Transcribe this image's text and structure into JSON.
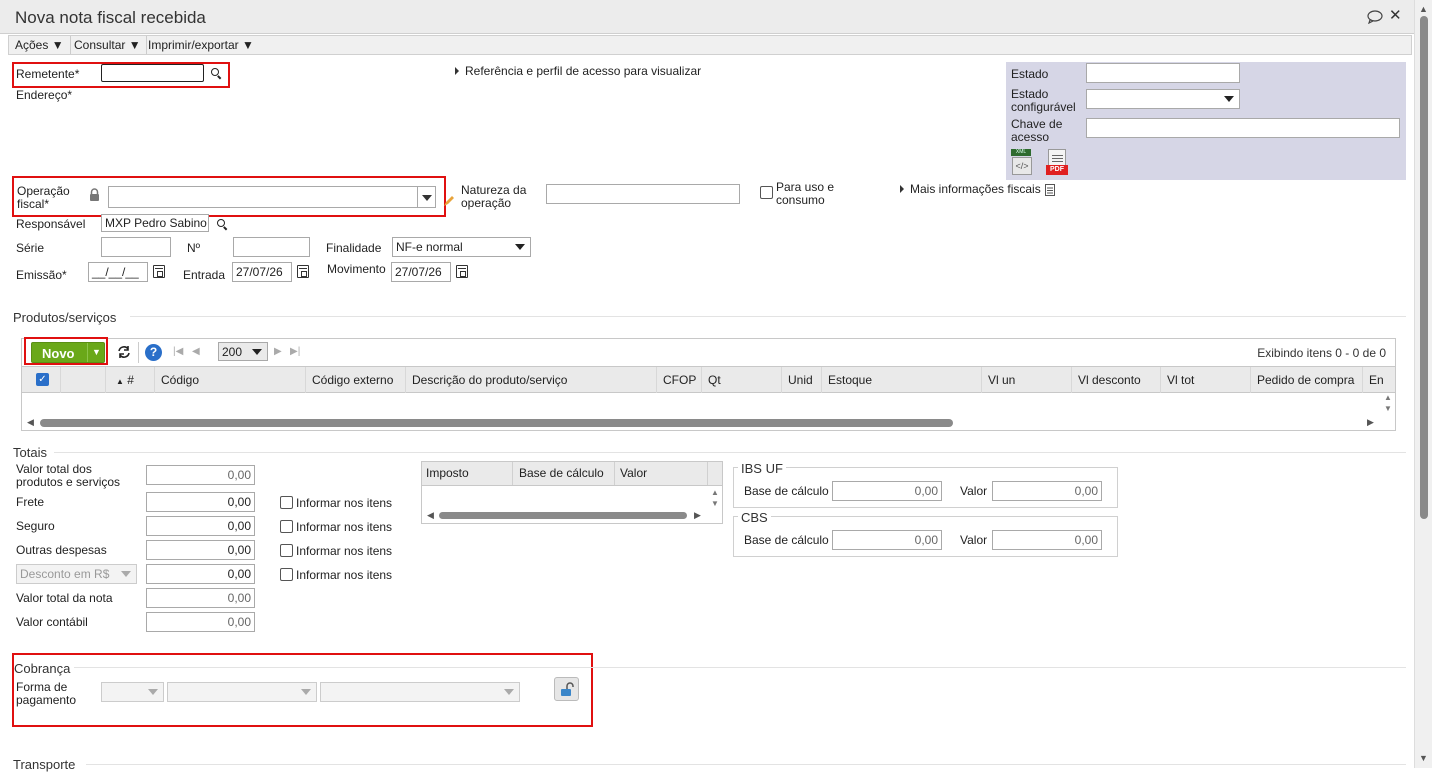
{
  "window": {
    "title": "Nova nota fiscal recebida"
  },
  "menu": {
    "acoes": "Ações",
    "consultar": "Consultar",
    "imprimir": "Imprimir/exportar"
  },
  "header": {
    "remetente_label": "Remetente*",
    "remetente_value": "",
    "endereco_label": "Endereço*",
    "referencia_link": "Referência e perfil de acesso para visualizar"
  },
  "side_panel": {
    "estado_label": "Estado",
    "estado_value": "",
    "estado_config_label_1": "Estado",
    "estado_config_label_2": "configurável",
    "estado_config_value": "",
    "chave_label_1": "Chave de",
    "chave_label_2": "acesso",
    "chave_value": "",
    "xml_badge": "XML",
    "pdf_badge": "PDF"
  },
  "operacao": {
    "label_1": "Operação",
    "label_2": "fiscal*",
    "value": "",
    "natureza_label_1": "Natureza da",
    "natureza_label_2": "operação",
    "natureza_value": "",
    "uso_consumo_1": "Para uso e",
    "uso_consumo_2": "consumo",
    "mais_info": "Mais informações fiscais"
  },
  "responsavel": {
    "label": "Responsável",
    "value": "MXP Pedro Sabino"
  },
  "serie": {
    "label": "Série",
    "value": "",
    "numero_label": "Nº",
    "numero_value": "",
    "finalidade_label": "Finalidade",
    "finalidade_value": "NF-e normal"
  },
  "datas": {
    "emissao_label": "Emissão*",
    "emissao_value": "__/__/__",
    "entrada_label": "Entrada",
    "entrada_value": "27/07/26",
    "movimento_label": "Movimento",
    "movimento_value": "27/07/26"
  },
  "produtos": {
    "section_title": "Produtos/serviços",
    "novo_button": "Novo",
    "page_size": "200",
    "exibindo": "Exibindo itens 0 - 0 de 0",
    "columns": [
      "#",
      "Código",
      "Código externo",
      "Descrição do produto/serviço",
      "CFOP",
      "Qt",
      "Unid",
      "Estoque",
      "Vl un",
      "Vl desconto",
      "Vl tot",
      "Pedido de compra",
      "En"
    ]
  },
  "totais": {
    "section_title": "Totais",
    "valor_total_1": "Valor total dos",
    "valor_total_2": "produtos e serviços",
    "valor_total_value": "0,00",
    "frete_label": "Frete",
    "frete_value": "0,00",
    "seguro_label": "Seguro",
    "seguro_value": "0,00",
    "outras_label": "Outras despesas",
    "outras_value": "0,00",
    "desconto_select": "Desconto em R$",
    "desconto_value": "0,00",
    "valor_nota_label": "Valor total da nota",
    "valor_nota_value": "0,00",
    "valor_contabil_label": "Valor contábil",
    "valor_contabil_value": "0,00",
    "informar_itens": "Informar nos itens"
  },
  "impostos": {
    "columns": [
      "Imposto",
      "Base de cálculo",
      "Valor"
    ]
  },
  "ibs_uf": {
    "title": "IBS UF",
    "base_label": "Base de cálculo",
    "base_value": "0,00",
    "valor_label": "Valor",
    "valor_value": "0,00"
  },
  "cbs": {
    "title": "CBS",
    "base_label": "Base de cálculo",
    "base_value": "0,00",
    "valor_label": "Valor",
    "valor_value": "0,00"
  },
  "cobranca": {
    "section_title": "Cobrança",
    "forma_1": "Forma de",
    "forma_2": "pagamento"
  },
  "transporte": {
    "section_title": "Transporte"
  },
  "colors": {
    "accent_red": "#e01010",
    "novo_green": "#6aa819",
    "side_panel_bg": "#d6d6e6",
    "help_blue": "#2a6fc9"
  }
}
